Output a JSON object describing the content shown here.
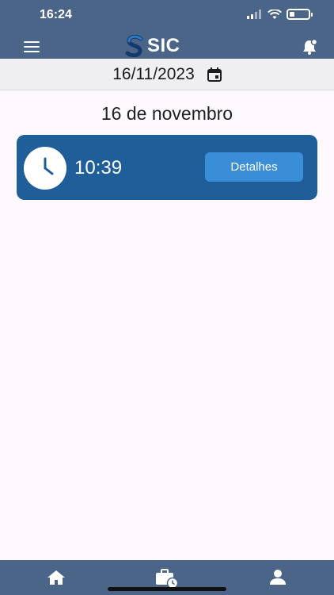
{
  "status_bar": {
    "time": "16:24"
  },
  "header": {
    "brand": "SIC"
  },
  "date_bar": {
    "date": "16/11/2023"
  },
  "main": {
    "day_title": "16 de novembro",
    "entries": [
      {
        "time": "10:39",
        "details_label": "Detalhes"
      }
    ]
  },
  "bottom_nav": {
    "items": [
      {
        "icon": "home-icon"
      },
      {
        "icon": "briefcase-clock-icon"
      },
      {
        "icon": "user-icon"
      }
    ]
  },
  "colors": {
    "header_bg": "#4a6587",
    "card_bg": "#1f5e99",
    "button_bg": "#3a8ed8",
    "date_bar_bg": "#efeff1"
  }
}
